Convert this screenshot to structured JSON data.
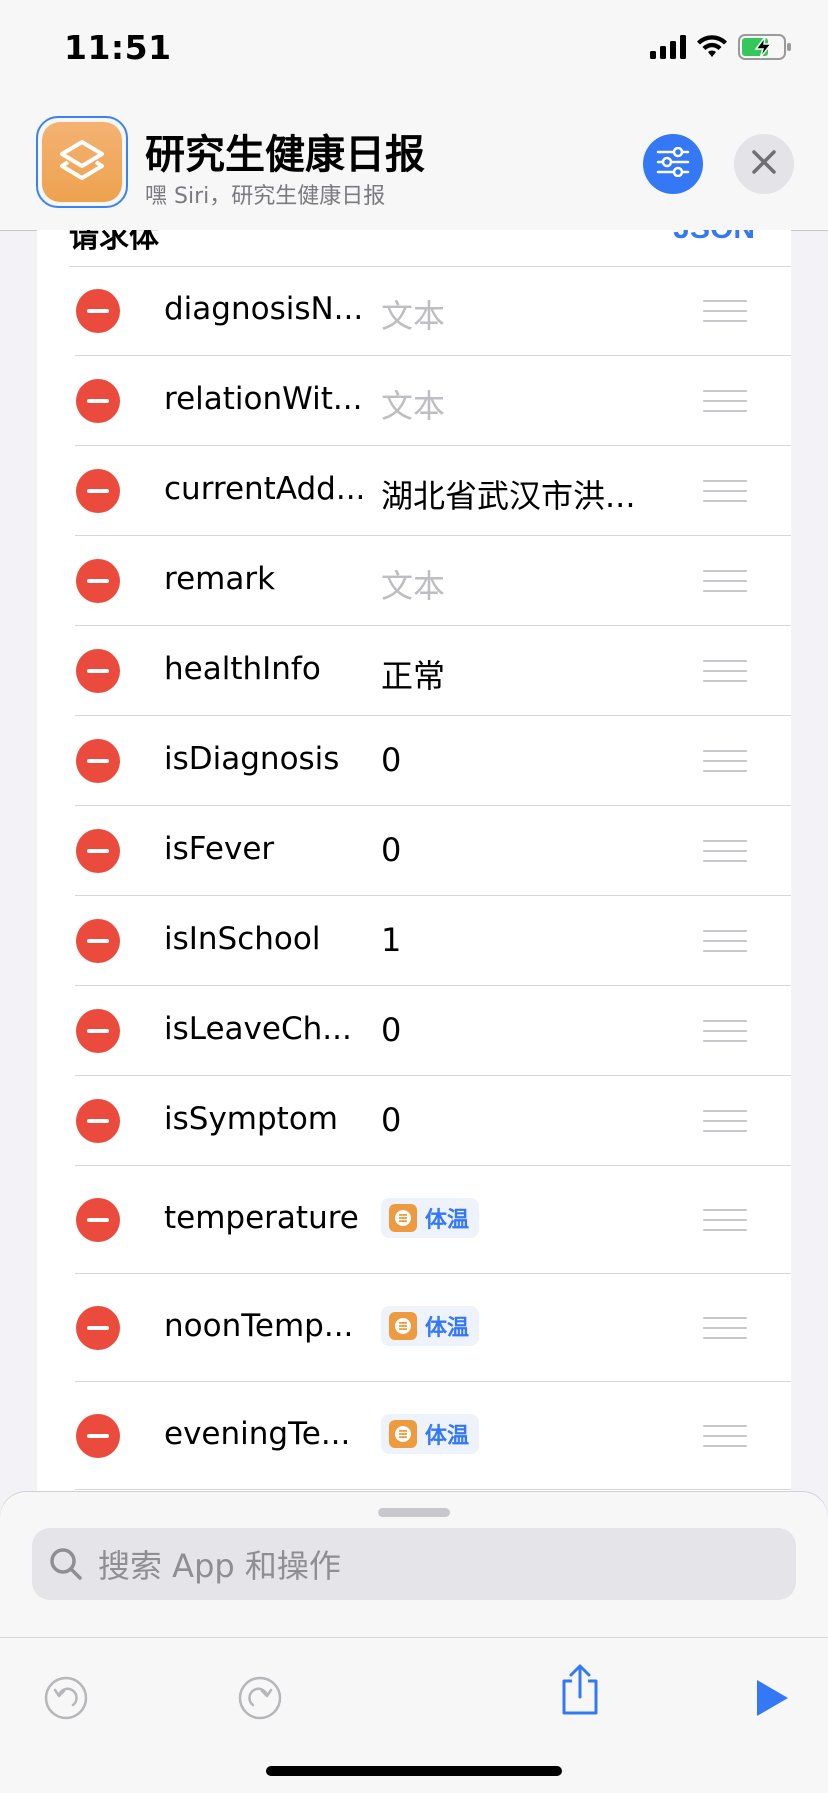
{
  "status_bar": {
    "time": "11:51"
  },
  "header": {
    "shortcut_name": "研究生健康日报",
    "siri_phrase": "嘿 Siri，研究生健康日报"
  },
  "card": {
    "title": "请求体",
    "right_label": "JSON",
    "rows": [
      {
        "key": "diagnosisN...",
        "value": "文本",
        "type": "placeholder"
      },
      {
        "key": "relationWit...",
        "value": "文本",
        "type": "placeholder"
      },
      {
        "key": "currentAdd...",
        "value": "湖北省武汉市洪...",
        "type": "text"
      },
      {
        "key": "remark",
        "value": "文本",
        "type": "placeholder"
      },
      {
        "key": "healthInfo",
        "value": "正常",
        "type": "text"
      },
      {
        "key": "isDiagnosis",
        "value": "0",
        "type": "text"
      },
      {
        "key": "isFever",
        "value": "0",
        "type": "text"
      },
      {
        "key": "isInSchool",
        "value": "1",
        "type": "text"
      },
      {
        "key": "isLeaveCh...",
        "value": "0",
        "type": "text"
      },
      {
        "key": "isSymptom",
        "value": "0",
        "type": "text"
      },
      {
        "key": "temperature",
        "value": "体温",
        "type": "variable"
      },
      {
        "key": "noonTemp...",
        "value": "体温",
        "type": "variable"
      },
      {
        "key": "eveningTe...",
        "value": "体温",
        "type": "variable"
      }
    ]
  },
  "search": {
    "placeholder": "搜索 App 和操作"
  },
  "colors": {
    "accent": "#3478f6",
    "delete": "#eb4b3d",
    "app_icon": "#eda24e"
  }
}
